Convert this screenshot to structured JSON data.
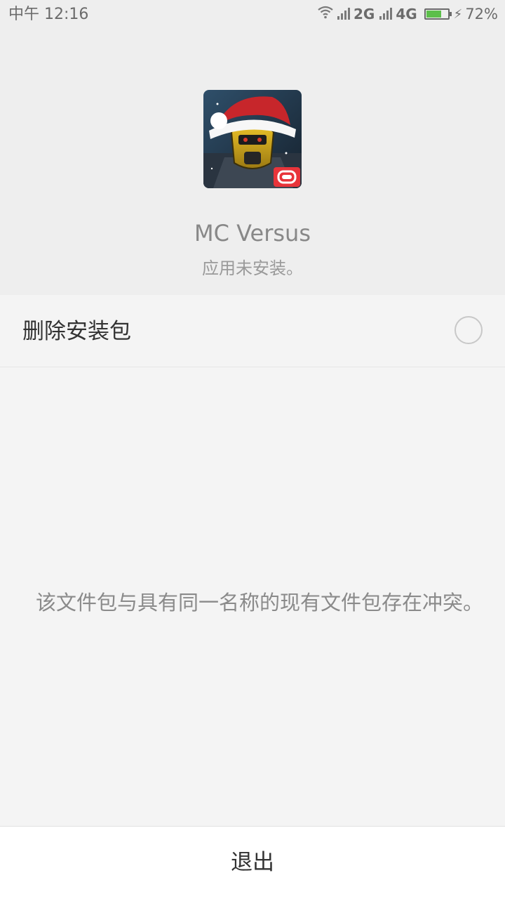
{
  "status_bar": {
    "time": "中午 12:16",
    "network_1": "2G",
    "network_2": "4G",
    "battery_percent": "72%",
    "battery_level": 0.72,
    "battery_color": "#5cbf4a",
    "icons": [
      "wifi-icon",
      "signal-icon",
      "signal-icon",
      "battery-icon",
      "charging-icon"
    ]
  },
  "app": {
    "icon": "mc-versus-app-icon",
    "name": "MC Versus",
    "status": "应用未安装。"
  },
  "option": {
    "label": "删除安装包",
    "checked": false
  },
  "message": "该文件包与具有同一名称的现有文件包存在冲突。",
  "footer": {
    "exit_label": "退出"
  },
  "colors": {
    "header_bg": "#eeeeee",
    "body_bg": "#f4f4f4",
    "icon_badge": "#e8343a"
  }
}
